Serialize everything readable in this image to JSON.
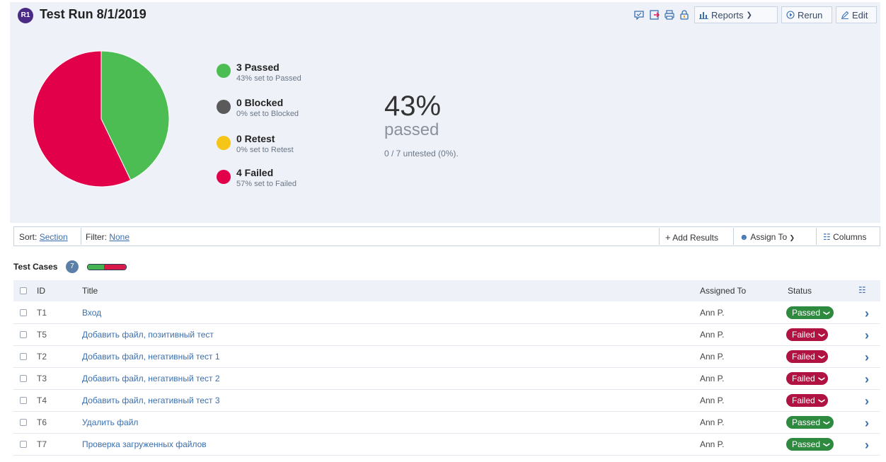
{
  "run": {
    "badge": "R1",
    "title": "Test Run 8/1/2019"
  },
  "toolbar": {
    "icons": [
      "chat-icon",
      "export-icon",
      "print-icon",
      "lock-icon"
    ],
    "reports_label": "Reports",
    "rerun_label": "Rerun",
    "edit_label": "Edit"
  },
  "chart_data": {
    "type": "pie",
    "labels": [
      "Passed",
      "Blocked",
      "Retest",
      "Failed"
    ],
    "values": [
      3,
      0,
      0,
      4
    ],
    "colors": [
      "#4bbd53",
      "#5a5a5a",
      "#f5c518",
      "#e3004a"
    ]
  },
  "legend": [
    {
      "title": "3 Passed",
      "sub": "43% set to Passed",
      "color": "#4bbd53"
    },
    {
      "title": "0 Blocked",
      "sub": "0% set to Blocked",
      "color": "#5a5a5a"
    },
    {
      "title": "0 Retest",
      "sub": "0% set to Retest",
      "color": "#f5c518"
    },
    {
      "title": "4 Failed",
      "sub": "57% set to Failed",
      "color": "#e3004a"
    }
  ],
  "summary": {
    "percent": "43%",
    "label": "passed",
    "untested": "0 / 7 untested (0%)."
  },
  "filterbar": {
    "sort_label": "Sort:",
    "sort_value": "Section",
    "filter_label": "Filter:",
    "filter_value": "None",
    "add_results": "Add Results",
    "assign_to": "Assign To",
    "columns": "Columns"
  },
  "test_cases": {
    "label": "Test Cases",
    "count": "7",
    "passed_fraction": 0.43
  },
  "table": {
    "headers": {
      "id": "ID",
      "title": "Title",
      "assigned": "Assigned To",
      "status": "Status"
    },
    "rows": [
      {
        "id": "T1",
        "title": "Вход",
        "assigned": "Ann P.",
        "status": "Passed"
      },
      {
        "id": "T5",
        "title": "Добавить файл, позитивный тест",
        "assigned": "Ann P.",
        "status": "Failed"
      },
      {
        "id": "T2",
        "title": "Добавить файл, негативный тест 1",
        "assigned": "Ann P.",
        "status": "Failed"
      },
      {
        "id": "T3",
        "title": "Добавить файл, негативный тест 2",
        "assigned": "Ann P.",
        "status": "Failed"
      },
      {
        "id": "T4",
        "title": "Добавить файл, негативный тест 3",
        "assigned": "Ann P.",
        "status": "Failed"
      },
      {
        "id": "T6",
        "title": "Удалить файл",
        "assigned": "Ann P.",
        "status": "Passed"
      },
      {
        "id": "T7",
        "title": "Проверка загруженных файлов",
        "assigned": "Ann P.",
        "status": "Passed"
      }
    ]
  }
}
